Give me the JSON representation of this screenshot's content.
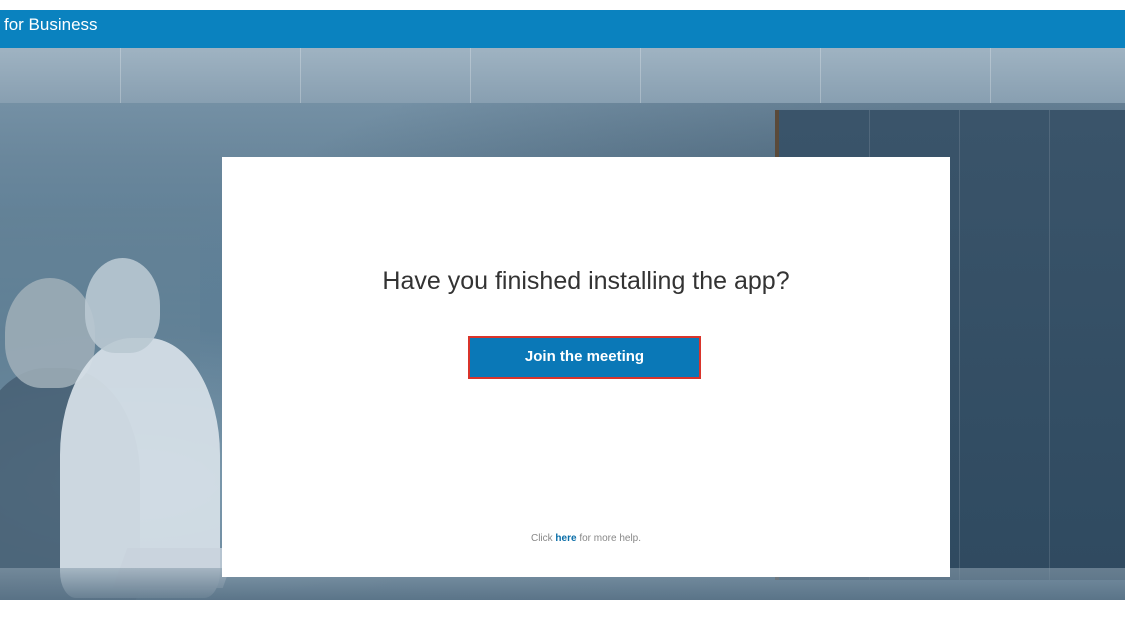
{
  "header": {
    "brand_text": "for Business",
    "bar_color": "#0a82bf"
  },
  "dialog": {
    "question": "Have you finished installing the app?",
    "join_button_label": "Join the meeting",
    "join_button_color": "#0a78b7",
    "join_button_highlight_color": "#d9342b",
    "help_prefix": "Click ",
    "help_link_text": "here",
    "help_suffix": " for more help."
  }
}
